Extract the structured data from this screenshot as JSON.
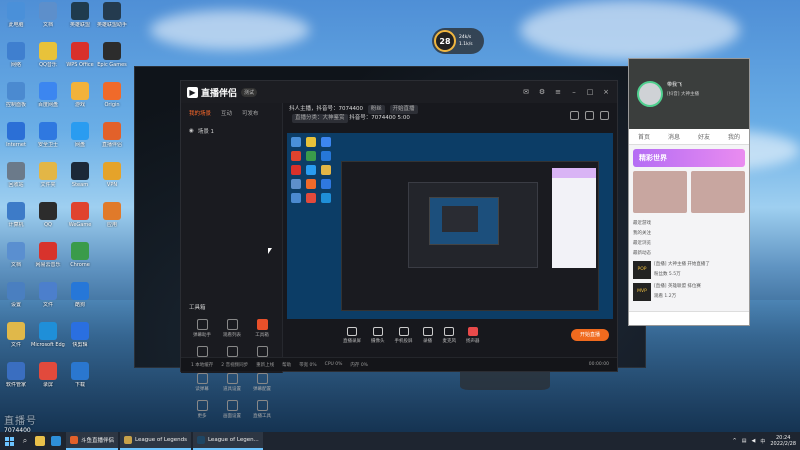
{
  "desktop": {
    "icons_col1": [
      {
        "label": "此电脑",
        "icon": "computer-icon",
        "color": "#4a90d9"
      },
      {
        "label": "网络",
        "icon": "network-icon",
        "color": "#3f7fcf"
      },
      {
        "label": "控制面板",
        "icon": "control-panel-icon",
        "color": "#4b8ad0"
      },
      {
        "label": "Internet",
        "icon": "ie-icon",
        "color": "#2b6fd6"
      },
      {
        "label": "回收站",
        "icon": "recycle-bin-icon",
        "color": "#6b7a8a"
      },
      {
        "label": "计算机",
        "icon": "pc-icon",
        "color": "#3d7bc8"
      },
      {
        "label": "文档",
        "icon": "document-icon",
        "color": "#5a8fd0"
      },
      {
        "label": "设置",
        "icon": "settings-icon",
        "color": "#4a7fc0"
      },
      {
        "label": "文件",
        "icon": "folder-icon",
        "color": "#e0b84a"
      },
      {
        "label": "软件管家",
        "icon": "app-manager-icon",
        "color": "#3a6ec0"
      }
    ],
    "icons_col2": [
      {
        "label": "文档",
        "icon": "doc-icon",
        "color": "#5d8fcb"
      },
      {
        "label": "QQ音乐",
        "icon": "qq-music-icon",
        "color": "#e8c23a"
      },
      {
        "label": "百度网盘",
        "icon": "baidu-disk-icon",
        "color": "#3c86f0"
      },
      {
        "label": "安全卫士",
        "icon": "shield-icon",
        "color": "#2f78e0"
      },
      {
        "label": "文件夹",
        "icon": "folder-icon",
        "color": "#e3b646"
      },
      {
        "label": "QQ",
        "icon": "qq-icon",
        "color": "#2c2c2c"
      },
      {
        "label": "网易云音乐",
        "icon": "music-icon",
        "color": "#d8332c"
      },
      {
        "label": "文件",
        "icon": "file-icon",
        "color": "#4c7fcc"
      },
      {
        "label": "Microsoft Edge",
        "icon": "edge-icon",
        "color": "#1f8fd8"
      },
      {
        "label": "录屏",
        "icon": "record-icon",
        "color": "#e24a3c"
      }
    ],
    "icons_col3": [
      {
        "label": "英雄联盟",
        "icon": "lol-icon",
        "color": "#1f3b4d"
      },
      {
        "label": "WPS Office",
        "icon": "wps-icon",
        "color": "#d9312b"
      },
      {
        "label": "游戏",
        "icon": "game-icon",
        "color": "#f2b23a"
      },
      {
        "label": "网盘",
        "icon": "cloud-icon",
        "color": "#2a9cf0"
      },
      {
        "label": "Steam",
        "icon": "steam-icon",
        "color": "#1b2838"
      },
      {
        "label": "WeGame",
        "icon": "wegame-icon",
        "color": "#e0432e"
      },
      {
        "label": "Chrome",
        "icon": "chrome-icon",
        "color": "#3a9b4a"
      },
      {
        "label": "酷狗",
        "icon": "kugou-icon",
        "color": "#2677d8"
      },
      {
        "label": "快剪辑",
        "icon": "video-edit-icon",
        "color": "#2a6fe0"
      },
      {
        "label": "下载",
        "icon": "download-icon",
        "color": "#2a77d0"
      }
    ],
    "icons_col4": [
      {
        "label": "英雄联盟助手",
        "icon": "lol-helper-icon",
        "color": "#243b4f"
      },
      {
        "label": "Epic Games",
        "icon": "epic-icon",
        "color": "#2c2c2c"
      },
      {
        "label": "Origin",
        "icon": "origin-icon",
        "color": "#f06a2a"
      },
      {
        "label": "直播伴侣",
        "icon": "live-icon",
        "color": "#e2612a"
      },
      {
        "label": "VPN",
        "icon": "vpn-icon",
        "color": "#e5a32a"
      },
      {
        "label": "应用",
        "icon": "app-icon",
        "color": "#e07a2a"
      }
    ],
    "epic_label": "EPIC",
    "v_label": "V"
  },
  "widget": {
    "speed": "28",
    "up": "24k/s",
    "down": "1.1k/s"
  },
  "stream_app": {
    "name": "直播伴侣",
    "badge": "测试",
    "tabs": [
      "我的场景",
      "互动",
      "互动",
      "可发布"
    ],
    "scene_label": "场景 1",
    "toolbox_title": "工具箱",
    "tools": [
      "弹幕助手",
      "观看列表",
      "工具箱",
      "视频连麦",
      "多人连麦",
      "推荐服务",
      "读弹幕",
      "道具设置",
      "弹幕配置",
      "更多",
      "画面设置",
      "直播工具"
    ],
    "header_line1": "抖人主播，抖音号：7074400",
    "header_tag1": "粉丝",
    "header_tag2": "开始直播",
    "header_line2_a": "直播分类：大神鉴赏",
    "header_line2_b": "抖音号：7074400",
    "header_line2_c": "5:00",
    "bottom_buttons": [
      "直播录屏",
      "摄像头",
      "手机投屏",
      "录播",
      "麦克风",
      "扬声器"
    ],
    "start_live": "开始直播",
    "status_left": "工作中",
    "status_items": [
      "1 本地缓存",
      "2 音视频同步",
      "重新上线",
      "帮助"
    ],
    "status_metrics": [
      "带宽 0%",
      "CPU 0%",
      "内存 0%"
    ],
    "status_time": "00:00:00"
  },
  "chat_panel": {
    "username": "带我飞",
    "signature": "[抖音] 大神主播",
    "tabs": [
      "首页",
      "消息",
      "好友",
      "我的"
    ],
    "banner": "精彩世界",
    "list_header": "最新动态",
    "items": [
      {
        "title": "[直播] 大神主播 开始直播了",
        "meta": "POP",
        "sub": "粉丝数 5.5万"
      },
      {
        "title": "[直播] 英雄联盟 排位赛",
        "meta": "MVP",
        "sub": "观看 1.2万"
      }
    ],
    "section_labels": [
      "最近游戏",
      "我的关注",
      "最近浏览"
    ]
  },
  "watermark": {
    "big": "直播号",
    "id": "7074400"
  },
  "taskbar": {
    "tasks": [
      {
        "label": "斗鱼直播伴侣",
        "color": "#e2612a"
      },
      {
        "label": "League of Legends",
        "color": "#c8a24a"
      },
      {
        "label": "League of Legen...",
        "color": "#1e4664"
      }
    ],
    "time": "20:24",
    "date": "2022/2/28",
    "ime": "中"
  }
}
